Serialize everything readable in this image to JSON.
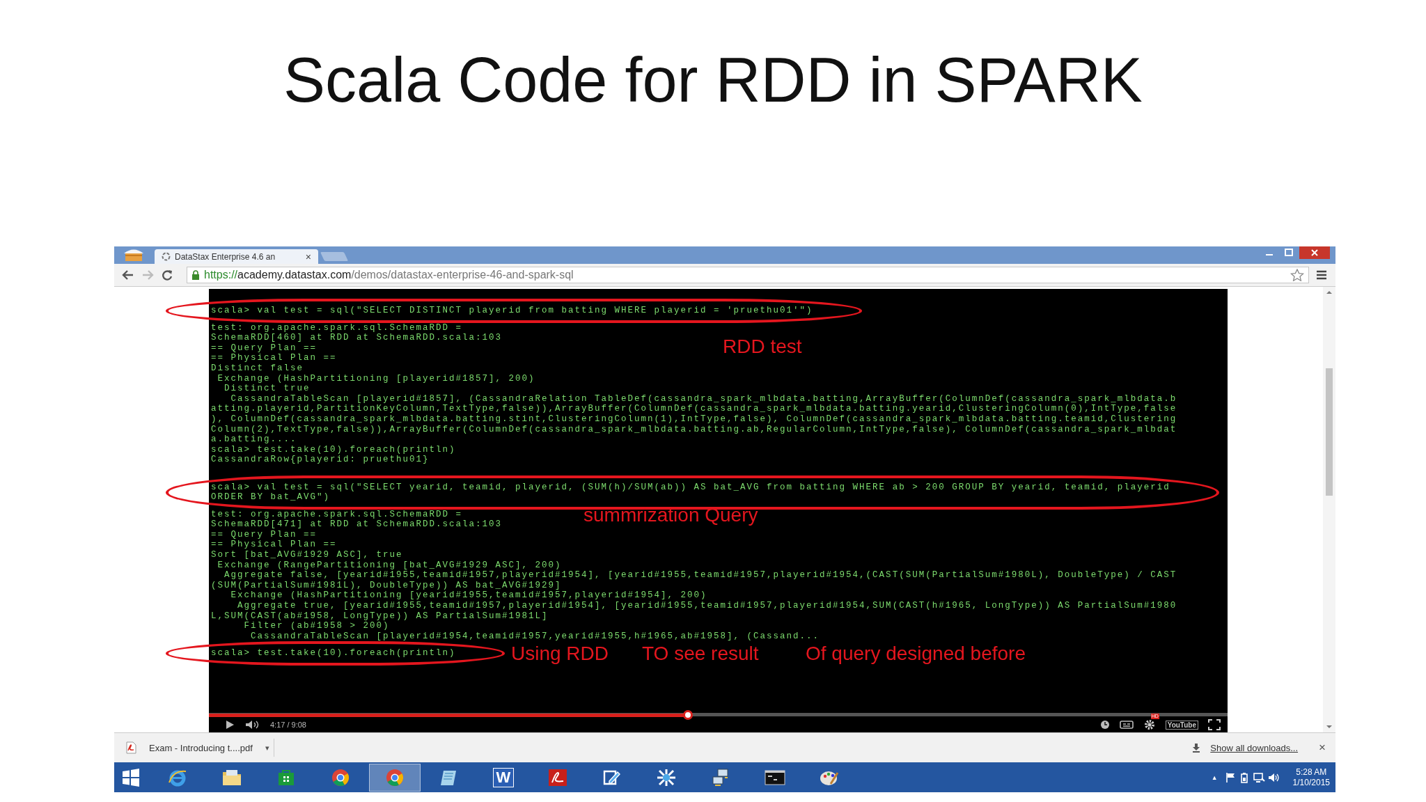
{
  "slide_title": "Scala Code for RDD in SPARK",
  "browser": {
    "tab": {
      "title": "DataStax Enterprise 4.6 an",
      "close": "×"
    },
    "url": {
      "scheme": "https://",
      "host": "academy.datastax.com",
      "path": "/demos/datastax-enterprise-46-and-spark-sql"
    }
  },
  "terminal": {
    "blocks": [
      [
        {
          "circled": true,
          "lines": [
            "scala> val test = sql(\"SELECT DISTINCT playerid from batting WHERE playerid = 'pruethu01'\")"
          ]
        },
        {
          "circled": false,
          "lines": [
            "test: org.apache.spark.sql.SchemaRDD =",
            "SchemaRDD[460] at RDD at SchemaRDD.scala:103",
            "== Query Plan ==",
            "== Physical Plan ==",
            "Distinct false",
            " Exchange (HashPartitioning [playerid#1857], 200)",
            "  Distinct true",
            "   CassandraTableScan [playerid#1857], (CassandraRelation TableDef(cassandra_spark_mlbdata.batting,ArrayBuffer(ColumnDef(cassandra_spark_mlbdata.b",
            "atting.playerid,PartitionKeyColumn,TextType,false)),ArrayBuffer(ColumnDef(cassandra_spark_mlbdata.batting.yearid,ClusteringColumn(0),IntType,false",
            "), ColumnDef(cassandra_spark_mlbdata.batting.stint,ClusteringColumn(1),IntType,false), ColumnDef(cassandra_spark_mlbdata.batting.teamid,Clustering",
            "Column(2),TextType,false)),ArrayBuffer(ColumnDef(cassandra_spark_mlbdata.batting.ab,RegularColumn,IntType,false), ColumnDef(cassandra_spark_mlbdat",
            "a.batting....",
            "scala> test.take(10).foreach(println)",
            "CassandraRow{playerid: pruethu01}"
          ]
        }
      ],
      [
        {
          "circled": true,
          "lines": [
            "scala> val test = sql(\"SELECT yearid, teamid, playerid, (SUM(h)/SUM(ab)) AS bat_AVG from batting WHERE ab > 200 GROUP BY yearid, teamid, playerid",
            "ORDER BY bat_AVG\")"
          ]
        },
        {
          "circled": false,
          "lines": [
            "test: org.apache.spark.sql.SchemaRDD =",
            "SchemaRDD[471] at RDD at SchemaRDD.scala:103",
            "== Query Plan ==",
            "== Physical Plan ==",
            "Sort [bat_AVG#1929 ASC], true",
            " Exchange (RangePartitioning [bat_AVG#1929 ASC], 200)",
            "  Aggregate false, [yearid#1955,teamid#1957,playerid#1954], [yearid#1955,teamid#1957,playerid#1954,(CAST(SUM(PartialSum#1980L), DoubleType) / CAST",
            "(SUM(PartialSum#1981L), DoubleType)) AS bat_AVG#1929]",
            "   Exchange (HashPartitioning [yearid#1955,teamid#1957,playerid#1954], 200)",
            "    Aggregate true, [yearid#1955,teamid#1957,playerid#1954], [yearid#1955,teamid#1957,playerid#1954,SUM(CAST(h#1965, LongType)) AS PartialSum#1980",
            "L,SUM(CAST(ab#1958, LongType)) AS PartialSum#1981L]",
            "     Filter (ab#1958 > 200)",
            "      CassandraTableScan [playerid#1954,teamid#1957,yearid#1955,h#1965,ab#1958], (Cassand..."
          ]
        },
        {
          "circled": true,
          "lines": [
            "scala> test.take(10).foreach(println)"
          ]
        }
      ]
    ]
  },
  "notes": [
    {
      "text": "RDD test"
    },
    {
      "text": "summrization Query"
    },
    {
      "text": "Using RDD"
    },
    {
      "text": "TO see result"
    },
    {
      "text": "Of query designed before"
    }
  ],
  "video": {
    "level": 0.47,
    "time": "4:17 / 9:08",
    "hd_badge": "HD",
    "logo": "YouTube"
  },
  "downloads": {
    "file": "Exam - Introducing t....pdf",
    "caret": "▾",
    "show_all": "Show all downloads...",
    "close": "×"
  },
  "taskbar": {
    "apps": [
      {
        "kind": "ie",
        "selected": false
      },
      {
        "kind": "folder",
        "selected": false
      },
      {
        "kind": "store",
        "selected": false
      },
      {
        "kind": "chrome",
        "selected": false
      },
      {
        "kind": "chrome",
        "selected": true
      },
      {
        "kind": "notes",
        "selected": false
      },
      {
        "kind": "word",
        "selected": false,
        "label": "W"
      },
      {
        "kind": "acrobat",
        "selected": false
      },
      {
        "kind": "pen",
        "selected": false
      },
      {
        "kind": "tool",
        "selected": false
      },
      {
        "kind": "network",
        "selected": false
      },
      {
        "kind": "terminal",
        "selected": false
      },
      {
        "kind": "paint",
        "selected": false
      }
    ],
    "tray_arrow": "▲",
    "clock": {
      "time": "5:28 AM",
      "date": "1/10/2015"
    }
  }
}
